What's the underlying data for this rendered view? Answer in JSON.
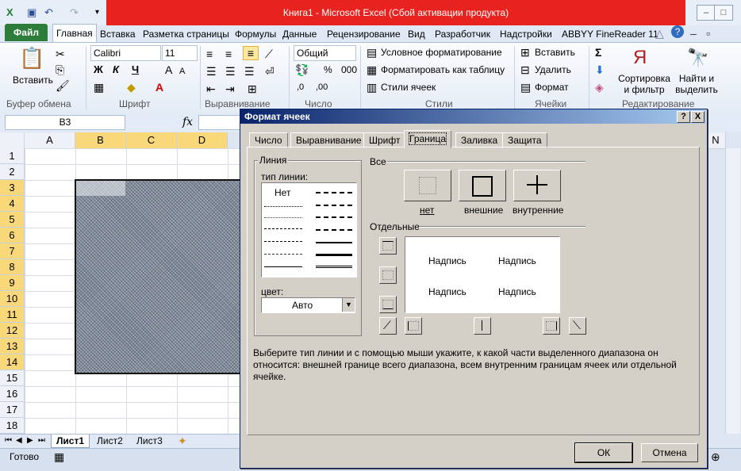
{
  "window": {
    "title": "Книга1 - Microsoft Excel (Сбой активации продукта)"
  },
  "ribbon": {
    "file_tab": "Файл",
    "tabs": [
      "Главная",
      "Вставка",
      "Разметка страницы",
      "Формулы",
      "Данные",
      "Рецензирование",
      "Вид",
      "Разработчик",
      "Надстройки",
      "ABBYY FineReader 11"
    ],
    "clipboard": {
      "paste": "Вставить",
      "group": "Буфер обмена"
    },
    "font": {
      "name": "Calibri",
      "size": "11",
      "bold": "Ж",
      "italic": "К",
      "underline": "Ч",
      "group": "Шрифт"
    },
    "alignment": {
      "group": "Выравнивание"
    },
    "number": {
      "format": "Общий",
      "group": "Число",
      "percent": "%",
      "thousands": "000"
    },
    "styles": {
      "cond": "Условное форматирование",
      "table": "Форматировать как таблицу",
      "cell": "Стили ячеек",
      "group": "Стили"
    },
    "cells": {
      "insert": "Вставить",
      "delete": "Удалить",
      "format": "Формат",
      "group": "Ячейки"
    },
    "editing": {
      "sort": "Сортировка и фильтр",
      "find": "Найти и выделить",
      "group": "Редактирование"
    }
  },
  "formula_bar": {
    "name_box": "B3",
    "fx": "fx"
  },
  "grid": {
    "columns": [
      "A",
      "B",
      "C",
      "D"
    ],
    "rows": [
      "1",
      "2",
      "3",
      "4",
      "5",
      "6",
      "7",
      "8",
      "9",
      "10",
      "11",
      "12",
      "13",
      "14",
      "15",
      "16",
      "17",
      "18"
    ],
    "last_col": "N"
  },
  "sheets": [
    "Лист1",
    "Лист2",
    "Лист3"
  ],
  "status": {
    "ready": "Готово"
  },
  "dialog": {
    "title": "Формат ячеек",
    "help": "?",
    "close": "X",
    "tabs": [
      "Число",
      "Выравнивание",
      "Шрифт",
      "Граница",
      "Заливка",
      "Защита"
    ],
    "line_group": "Линия",
    "line_type": "тип линии:",
    "line_none": "Нет",
    "color_label": "цвет:",
    "color_value": "Авто",
    "presets_group": "Все",
    "preset_none": "нет",
    "preset_outer": "внешние",
    "preset_inner": "внутренние",
    "border_group": "Отдельные",
    "preview_text": "Надпись",
    "hint": "Выберите тип линии и с помощью мыши укажите, к какой части выделенного диапазона он относится: внешней границе всего диапазона, всем внутренним границам ячеек или отдельной ячейке.",
    "ok": "ОК",
    "cancel": "Отмена"
  }
}
